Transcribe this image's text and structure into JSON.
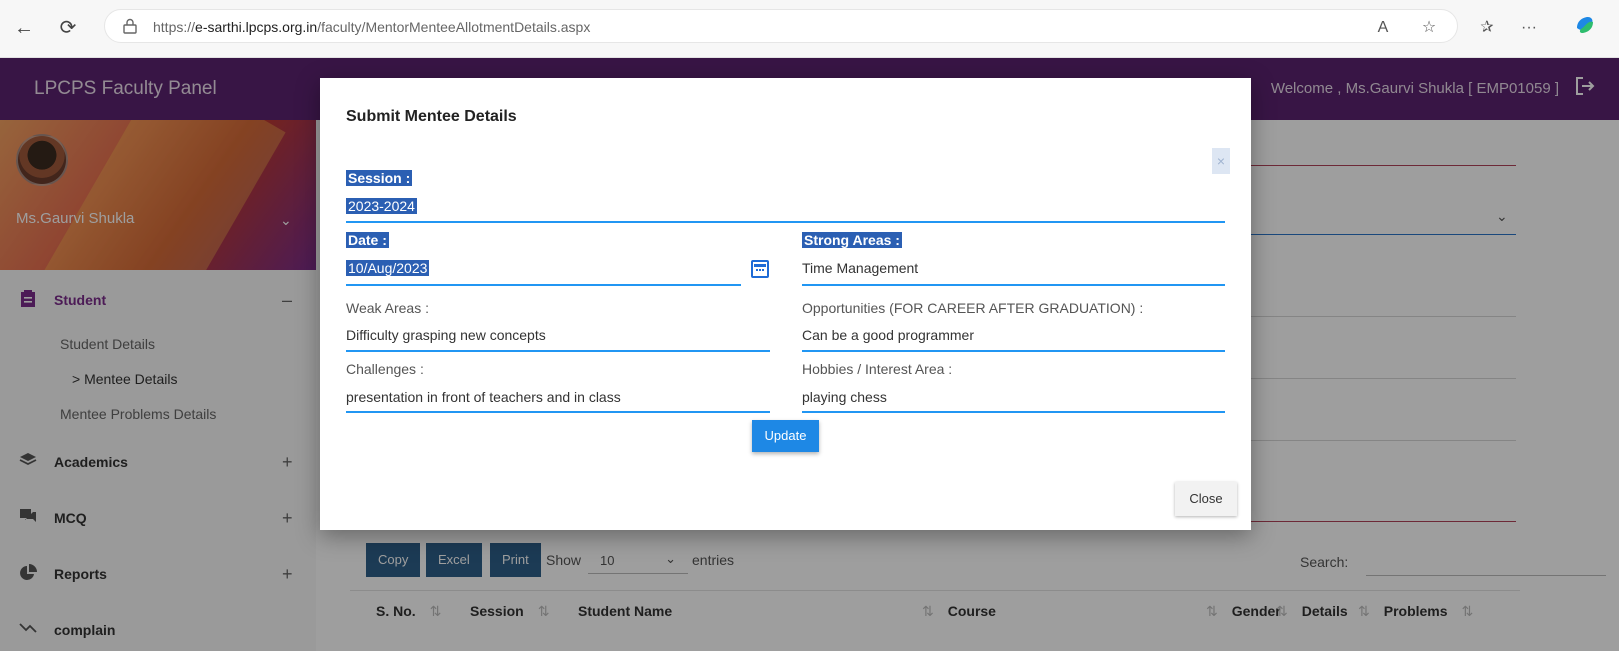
{
  "browser": {
    "url_prefix": "https://",
    "url_domain": "e-sarthi.lpcps.org.in",
    "url_path": "/faculty/MentorMenteeAllotmentDetails.aspx",
    "read_aloud": "A",
    "more": "···"
  },
  "header": {
    "app_title": "LPCPS Faculty Panel",
    "welcome": "Welcome , Ms.Gaurvi Shukla [ EMP01059 ]"
  },
  "sidebar": {
    "profile_name": "Ms.Gaurvi Shukla",
    "menu": [
      {
        "label": "Student",
        "toggle": "–"
      },
      {
        "label": "Academics",
        "toggle": "+"
      },
      {
        "label": "MCQ",
        "toggle": "+"
      },
      {
        "label": "Reports",
        "toggle": "+"
      },
      {
        "label": "complain",
        "toggle": ""
      }
    ],
    "student_sub": [
      "Student Details",
      "> Mentee Details",
      "Mentee Problems Details"
    ]
  },
  "table": {
    "buttons": [
      "Copy",
      "Excel",
      "Print"
    ],
    "show_label": "Show",
    "entries_value": "10",
    "entries_label": "entries",
    "search_label": "Search:",
    "headers": [
      "S. No.",
      "Session",
      "Student Name",
      "Course",
      "Gender",
      "Details",
      "Problems"
    ]
  },
  "modal": {
    "title": "Submit Mentee Details",
    "close_x": "×",
    "session_label": "Session :",
    "session_value": "2023-2024",
    "date_label": "Date :",
    "date_value": "10/Aug/2023",
    "strong_label": "Strong Areas :",
    "strong_value": "Time Management",
    "weak_label": "Weak Areas :",
    "weak_value": "Difficulty grasping new concepts",
    "opp_label": "Opportunities (FOR CAREER AFTER GRADUATION) :",
    "opp_value": "Can be a good programmer",
    "challenges_label": "Challenges :",
    "challenges_value": "presentation in front of teachers and in class",
    "hobbies_label": "Hobbies / Interest Area :",
    "hobbies_value": "playing chess",
    "update_label": "Update",
    "close_label": "Close"
  },
  "colors": {
    "header_bg": "#5b2370",
    "accent_blue": "#2196f3",
    "selection": "#2b5fb3"
  }
}
